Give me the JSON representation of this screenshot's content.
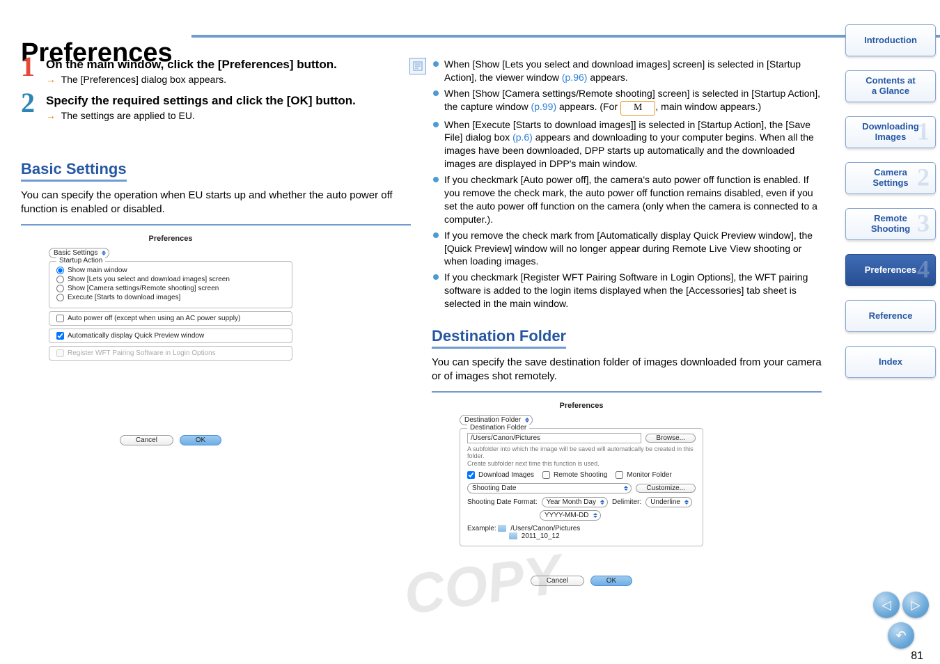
{
  "title": "Preferences",
  "step1": {
    "heading": "On the main window, click the [Preferences] button.",
    "result": "The [Preferences] dialog box appears."
  },
  "step2": {
    "heading": "Specify the required settings and click the [OK] button.",
    "result": "The settings are applied to EU."
  },
  "basic": {
    "header": "Basic Settings",
    "desc": "You can specify the operation when EU starts up and whether the auto power off function is enabled or disabled.",
    "dialog": {
      "title": "Preferences",
      "tab": "Basic Settings",
      "group_legend": "Startup Action",
      "radios": [
        "Show main window",
        "Show [Lets you select and download images] screen",
        "Show [Camera settings/Remote shooting] screen",
        "Execute [Starts to download images]"
      ],
      "checks": [
        "Auto power off (except when using an AC power supply)",
        "Automatically display Quick Preview window",
        "Register WFT Pairing Software in Login Options"
      ],
      "cancel": "Cancel",
      "ok": "OK"
    }
  },
  "notes": [
    {
      "type": "link1",
      "text_a": "When [Show [Lets you select and download images] screen] is selected in [Startup Action], the viewer window ",
      "link": "(p.96)",
      "text_b": " appears."
    },
    {
      "type": "m",
      "text_a": "When [Show [Camera settings/Remote shooting] screen] is selected in [Startup Action], the capture window ",
      "link": "(p.99)",
      "text_b": " appears. (For ",
      "m": "M",
      "text_c": ", main window appears.)"
    },
    {
      "type": "p6",
      "text_a": "When [Execute [Starts to download images]] is selected in [Startup Action], the [Save File] dialog box ",
      "link": "(p.6)",
      "text_b": " appears and downloading to your computer begins. When all the images have been downloaded, DPP starts up automatically and the downloaded images are displayed in DPP's main window."
    },
    {
      "type": "plain",
      "text": "If you checkmark [Auto power off], the camera's auto power off function is enabled. If you remove the check mark, the auto power off function remains disabled, even if you set the auto power off function on the camera (only when the camera is connected to a computer.)."
    },
    {
      "type": "plain",
      "text": "If you remove the check mark from [Automatically display Quick Preview window], the [Quick Preview] window will no longer appear during Remote Live View shooting or when loading images."
    },
    {
      "type": "plain",
      "text": "If you checkmark [Register WFT Pairing Software in Login Options], the WFT pairing software is added to the login items displayed when the [Accessories] tab sheet is selected in the main window."
    }
  ],
  "dest": {
    "header": "Destination Folder",
    "desc": "You can specify the save destination folder of images downloaded from your camera or of images shot remotely.",
    "dialog": {
      "title": "Preferences",
      "tab": "Destination Folder",
      "group_legend": "Destination Folder",
      "path": "/Users/Canon/Pictures",
      "browse": "Browse...",
      "hint1": "A subfolder into which the image will be saved will automatically be created in this folder.",
      "hint2": "Create subfolder next time this function is used.",
      "check_dl": "Download Images",
      "check_rs": "Remote Shooting",
      "check_mf": "Monitor Folder",
      "rule_select": "Shooting Date",
      "customize": "Customize...",
      "fmt_label": "Shooting Date Format:",
      "fmt_select": "Year Month Day",
      "delim_label": "Delimiter:",
      "delim_select": "Underline",
      "fmt2": "YYYY-MM-DD",
      "ex_label": "Example:",
      "ex_path": "/Users/Canon/Pictures",
      "ex_sub": "2011_10_12",
      "cancel": "Cancel",
      "ok": "OK"
    }
  },
  "sidebar": [
    {
      "label": "Introduction",
      "num": ""
    },
    {
      "label": "Contents at\na Glance",
      "num": ""
    },
    {
      "label": "Downloading\nImages",
      "num": "1"
    },
    {
      "label": "Camera\nSettings",
      "num": "2"
    },
    {
      "label": "Remote\nShooting",
      "num": "3"
    },
    {
      "label": "Preferences",
      "num": "4",
      "active": true
    },
    {
      "label": "Reference",
      "num": ""
    },
    {
      "label": "Index",
      "num": ""
    }
  ],
  "page_num": "81",
  "watermark": "COPY"
}
